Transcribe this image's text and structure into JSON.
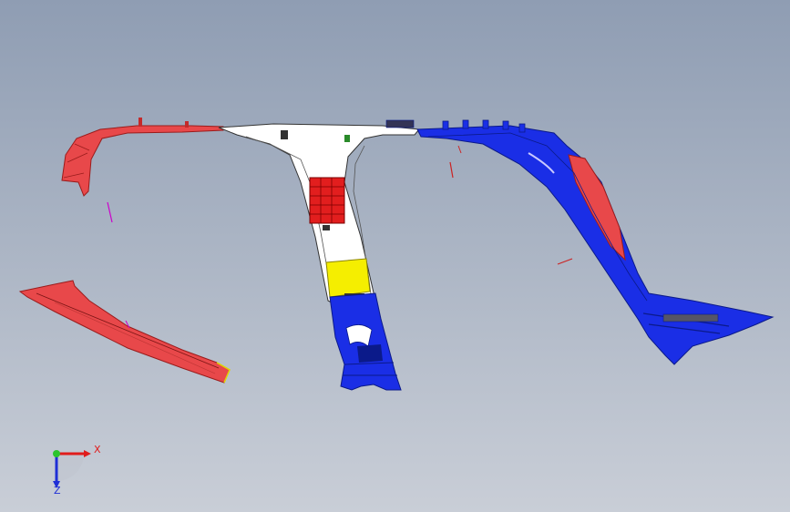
{
  "triad": {
    "x_label": "X",
    "z_label": "Z",
    "x_color": "#e01c1c",
    "y_color": "#2cc42c",
    "z_color": "#1f2fd6"
  },
  "model": {
    "part_colors": {
      "red": "#e8484a",
      "red_dark": "#9a1c1c",
      "blue": "#1a2ee6",
      "blue_dark": "#0b1a8a",
      "white": "#ffffff",
      "yellow": "#f5ee00",
      "red_block": "#e21e1e"
    }
  }
}
